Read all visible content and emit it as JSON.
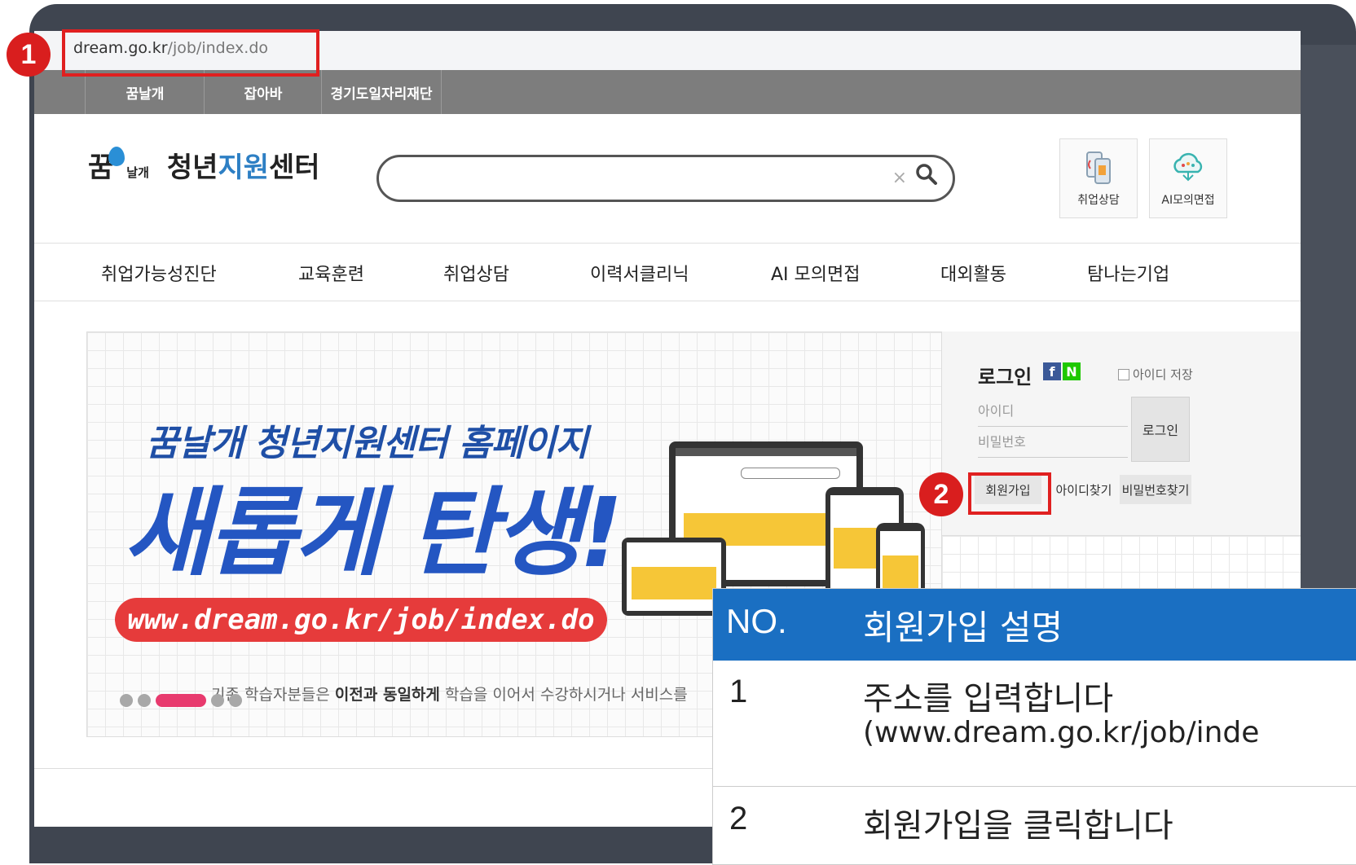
{
  "browser": {
    "address_domain": "dream.go.kr",
    "address_path": "/job/index.do"
  },
  "annotations": {
    "step1": "1",
    "step2": "2"
  },
  "top_nav": [
    "꿈날개",
    "잡아바",
    "경기도일자리재단"
  ],
  "logo": {
    "mark": "꿈",
    "sub": "날개",
    "title_dark1": "청년",
    "title_blue": "지원",
    "title_dark2": "센터"
  },
  "search": {
    "clear_glyph": "×",
    "placeholder": ""
  },
  "quick_links": [
    "취업상담",
    "AI모의면접"
  ],
  "main_menu": [
    "취업가능성진단",
    "교육훈련",
    "취업상담",
    "이력서클리닉",
    "AI 모의면접",
    "대외활동",
    "탐나는기업"
  ],
  "banner": {
    "headline": "꿈날개 청년지원센터 홈페이지",
    "main": "새롭게 탄생!",
    "url": "www.dream.go.kr/job/index.do",
    "notice_prefix": "기존 학습자분들은 ",
    "notice_bold": "이전과 동일하게",
    "notice_suffix": " 학습을 이어서 수강하시거나 서비스를"
  },
  "login": {
    "title": "로그인",
    "facebook": "f",
    "naver": "N",
    "save_id": "아이디 저장",
    "id_placeholder": "아이디",
    "pw_placeholder": "비밀번호",
    "login_button": "로그인",
    "join": "회원가입",
    "find_id": "아이디찾기",
    "find_pw": "비밀번호찾기"
  },
  "instructions": {
    "header_no": "NO.",
    "header_desc": "회원가입 설명",
    "rows": [
      {
        "no": "1",
        "line1": "주소를 입력합니다",
        "line2": "(www.dream.go.kr/job/inde"
      },
      {
        "no": "2",
        "line1": "회원가입을 클릭합니다",
        "line2": ""
      }
    ]
  },
  "colors": {
    "highlight_red": "#e02020",
    "badge_red": "#d91e1e",
    "table_header_blue": "#1a6fc2",
    "banner_blue": "#2456c2",
    "banner_url_red": "#e63b3b"
  }
}
